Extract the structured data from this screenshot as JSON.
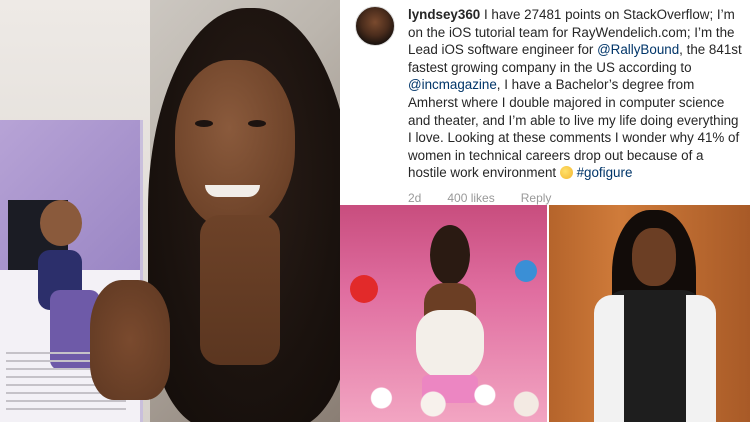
{
  "post": {
    "username": "lyndsey360",
    "text_parts": {
      "p1": " I have 27481 points on StackOverflow; I’m on the iOS tutorial team for RayWendelich.com; I’m the Lead iOS software engineer for ",
      "mention1": "@RallyBound",
      "p2": ", the 841st fastest growing company in the US according to ",
      "mention2": "@incmagazine",
      "p3": ", I have a Bachelor’s degree from Amherst where I double majored in computer science and theater, and I’m able to live my life doing everything I love. Looking at these comments I wonder why 41% of women in technical careers drop out because of a hostile work environment ",
      "emoji": "thinking-face",
      "hashtag": "#gofigure"
    },
    "meta": {
      "age": "2d",
      "likes": "400 likes",
      "reply": "Reply"
    }
  },
  "colors": {
    "link": "#003569",
    "meta": "#999999",
    "text": "#262626"
  }
}
